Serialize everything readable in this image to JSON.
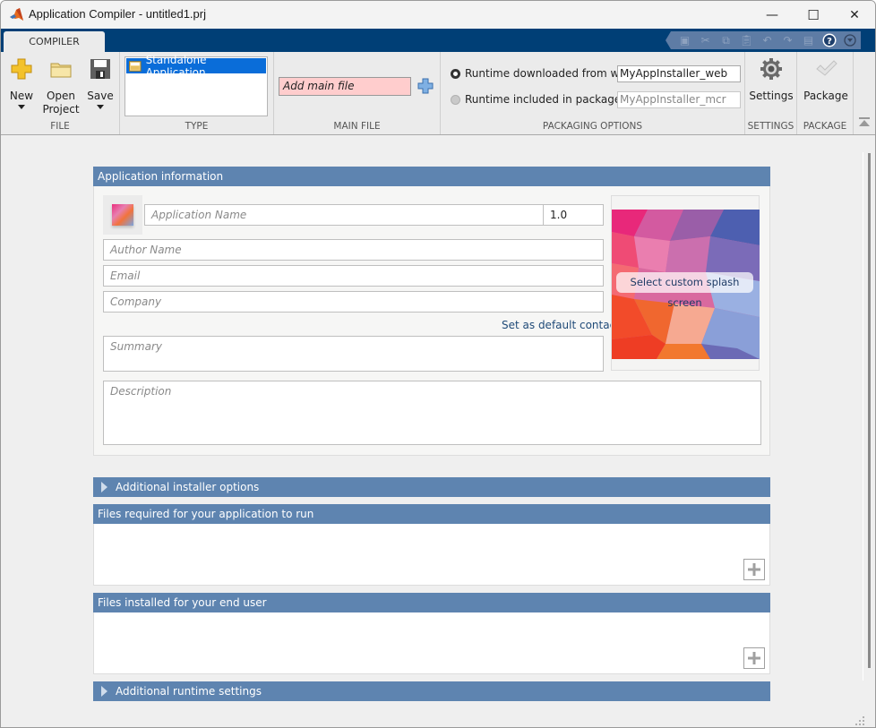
{
  "window": {
    "title": "Application Compiler - untitled1.prj",
    "controls": {
      "minimize": "—",
      "maximize": "☐",
      "close": "✕"
    }
  },
  "tabs": [
    {
      "label": "COMPILER",
      "active": true
    }
  ],
  "quick_access": [
    "save-icon",
    "cut-icon",
    "copy-icon",
    "paste-icon",
    "undo-icon",
    "redo-icon",
    "window-icon",
    "help-icon",
    "dropdown-icon"
  ],
  "ribbon": {
    "file": {
      "label": "FILE",
      "new_label": "New",
      "open_label_1": "Open",
      "open_label_2": "Project",
      "save_label": "Save"
    },
    "type": {
      "label": "TYPE",
      "items": [
        {
          "label": "Standalone Application",
          "selected": true
        }
      ]
    },
    "main_file": {
      "label": "MAIN FILE",
      "placeholder": "Add main file"
    },
    "packaging": {
      "label": "PACKAGING OPTIONS",
      "web_label": "Runtime downloaded from web",
      "web_value": "MyAppInstaller_web",
      "web_selected": true,
      "package_label": "Runtime included in package",
      "package_value": "MyAppInstaller_mcr",
      "package_selected": false
    },
    "settings": {
      "label": "SETTINGS",
      "button_label": "Settings"
    },
    "package": {
      "label": "PACKAGE",
      "button_label": "Package"
    }
  },
  "app_info": {
    "header": "Application information",
    "app_name_placeholder": "Application Name",
    "version": "1.0",
    "author_placeholder": "Author Name",
    "email_placeholder": "Email",
    "company_placeholder": "Company",
    "default_contact_link": "Set as default contact",
    "summary_placeholder": "Summary",
    "description_placeholder": "Description",
    "splash_button": "Select custom splash screen"
  },
  "sections": {
    "installer_options": "Additional installer options",
    "files_required": "Files required for your application to run",
    "files_installed": "Files installed for your end user",
    "runtime_settings": "Additional runtime settings"
  },
  "colors": {
    "tabstrip": "#003f76",
    "panel_header": "#5e84b0",
    "selection": "#0a6dd9",
    "main_file_error": "#ffcdcd",
    "link": "#1f4a78"
  }
}
